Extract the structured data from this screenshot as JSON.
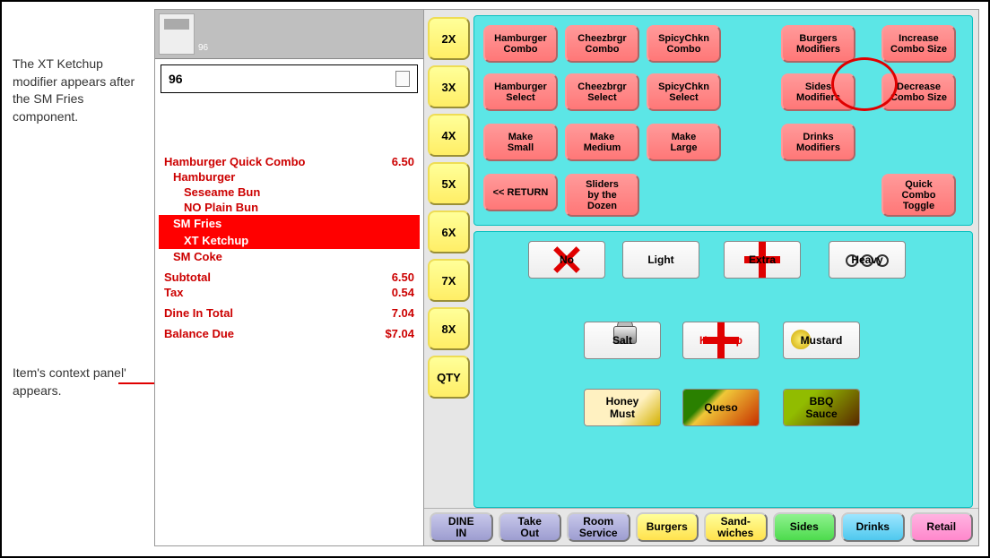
{
  "annotations": {
    "a1": "The XT Ketchup modifier appears after the SM Fries component.",
    "a2": "Item's context panel' appears."
  },
  "check": {
    "thumb_label": "96",
    "id": "96"
  },
  "order": {
    "line_main": "Hamburger Quick Combo",
    "line_main_price": "6.50",
    "sub1": "Hamburger",
    "sub2": "Seseame Bun",
    "sub2b": "NO  Plain Bun",
    "sub3": "SM Fries",
    "sub4": "XT  Ketchup",
    "sub5": "SM Coke"
  },
  "totals": {
    "subtotal_lbl": "Subtotal",
    "subtotal_val": "6.50",
    "tax_lbl": "Tax",
    "tax_val": "0.54",
    "type_lbl": "Dine In Total",
    "type_val": "7.04",
    "bal_lbl": "Balance Due",
    "bal_val": "$7.04"
  },
  "qty_buttons": [
    "2X",
    "3X",
    "4X",
    "5X",
    "6X",
    "7X",
    "8X",
    "QTY"
  ],
  "top_buttons": {
    "r1": [
      "Hamburger\nCombo",
      "Cheezbrgr\nCombo",
      "SpicyChkn\nCombo",
      "Burgers\nModifiers",
      "Increase\nCombo Size"
    ],
    "r2": [
      "Hamburger\nSelect",
      "Cheezbrgr\nSelect",
      "SpicyChkn\nSelect",
      "Sides\nModifiers",
      "Decrease\nCombo Size"
    ],
    "r3": [
      "Make\nSmall",
      "Make\nMedium",
      "Make\nLarge",
      "Drinks\nModifiers"
    ],
    "r4": [
      "<< RETURN",
      "Sliders\nby the\nDozen",
      "Quick\nCombo\nToggle"
    ]
  },
  "mods": {
    "no": "No",
    "light": "Light",
    "extra": "Extra",
    "heavy": "Heavy",
    "salt": "Salt",
    "ketchup": "Ketchup",
    "mustard": "Mustard",
    "honey": "Honey\nMust",
    "queso": "Queso",
    "bbq": "BBQ\nSauce"
  },
  "tabs": {
    "t1": "DINE\nIN",
    "t2": "Take\nOut",
    "t3": "Room\nService",
    "t4": "Burgers",
    "t5": "Sand-\nwiches",
    "t6": "Sides",
    "t7": "Drinks",
    "t8": "Retail"
  }
}
